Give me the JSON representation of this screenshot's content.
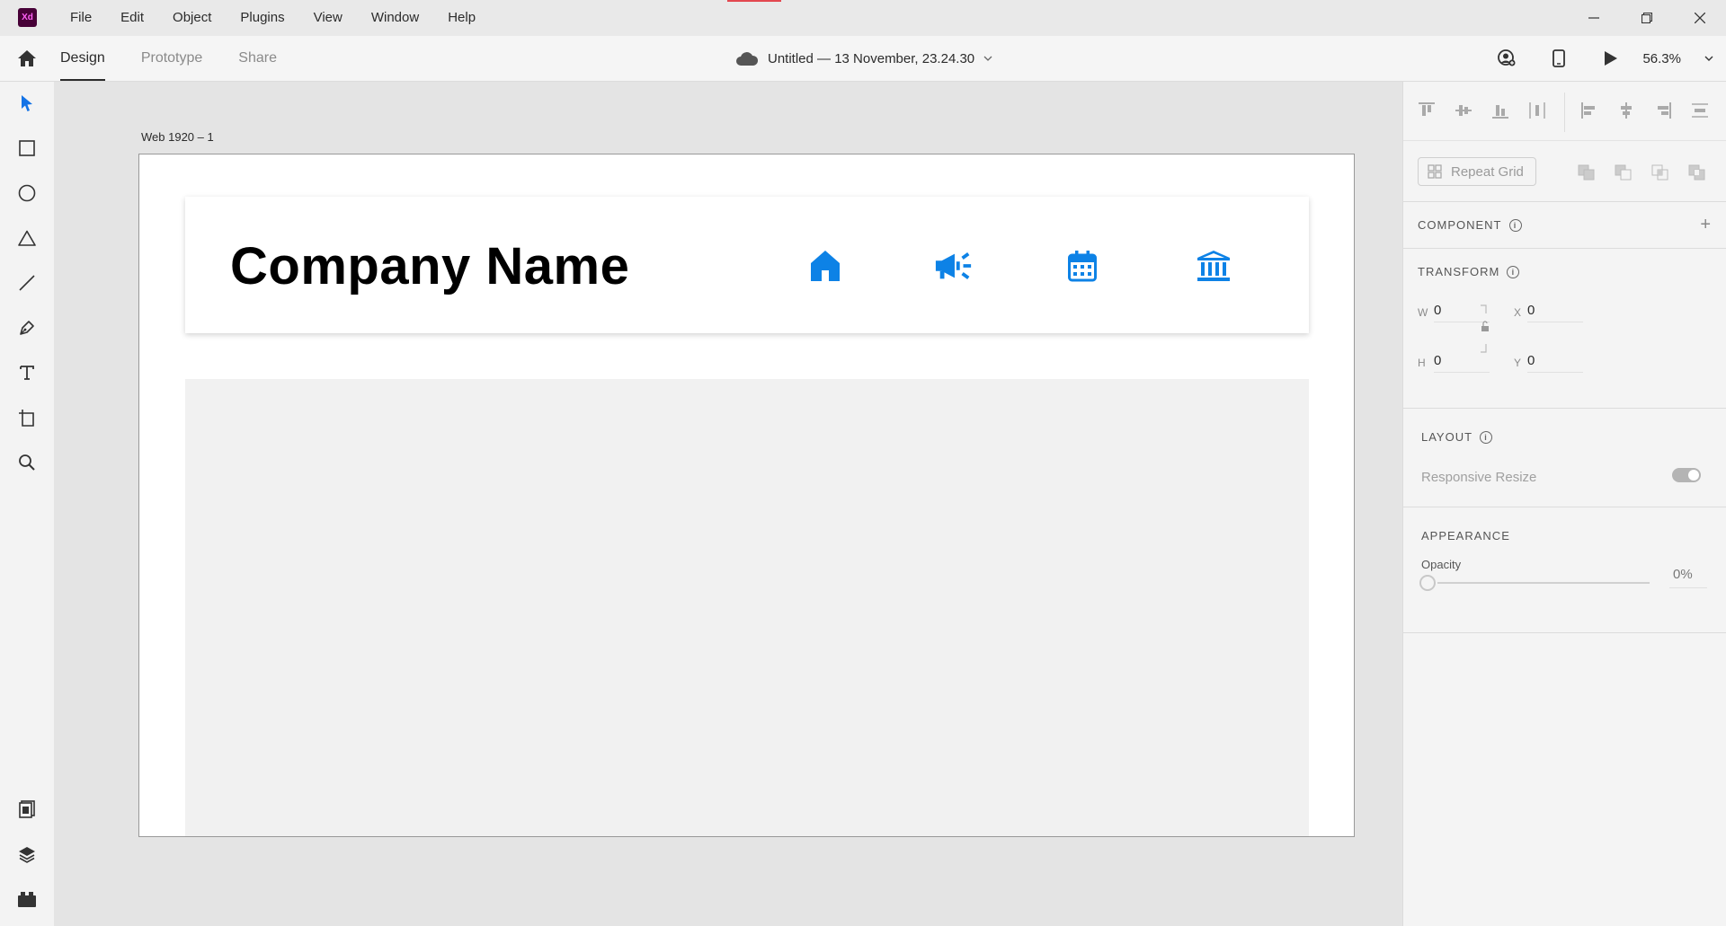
{
  "app": {
    "logo_text": "Xd"
  },
  "menu": [
    "File",
    "Edit",
    "Object",
    "Plugins",
    "View",
    "Window",
    "Help"
  ],
  "toolbar": {
    "tabs": [
      {
        "label": "Design",
        "active": true
      },
      {
        "label": "Prototype",
        "active": false
      },
      {
        "label": "Share",
        "active": false
      }
    ],
    "document_title": "Untitled — 13 November, 23.24.30",
    "zoom": "56.3%"
  },
  "tools": [
    "select-tool",
    "rectangle-tool",
    "ellipse-tool",
    "polygon-tool",
    "line-tool",
    "pen-tool",
    "text-tool",
    "artboard-tool",
    "zoom-tool"
  ],
  "bottom_tools": [
    "assets-panel",
    "layers-panel",
    "plugins-panel"
  ],
  "canvas": {
    "artboard_label": "Web 1920 – 1",
    "company_name": "Company Name",
    "nav_icons": [
      "home-icon",
      "megaphone-icon",
      "calendar-icon",
      "bank-icon"
    ],
    "accent_color": "#0d82e6"
  },
  "inspector": {
    "repeat_grid_label": "Repeat Grid",
    "component": {
      "title": "COMPONENT"
    },
    "transform": {
      "title": "TRANSFORM",
      "w_label": "W",
      "w_value": "0",
      "h_label": "H",
      "h_value": "0",
      "x_label": "X",
      "x_value": "0",
      "y_label": "Y",
      "y_value": "0"
    },
    "layout": {
      "title": "LAYOUT",
      "responsive_resize_label": "Responsive Resize",
      "responsive_resize_on": true
    },
    "appearance": {
      "title": "APPEARANCE",
      "opacity_label": "Opacity",
      "opacity_value": "0%"
    }
  }
}
